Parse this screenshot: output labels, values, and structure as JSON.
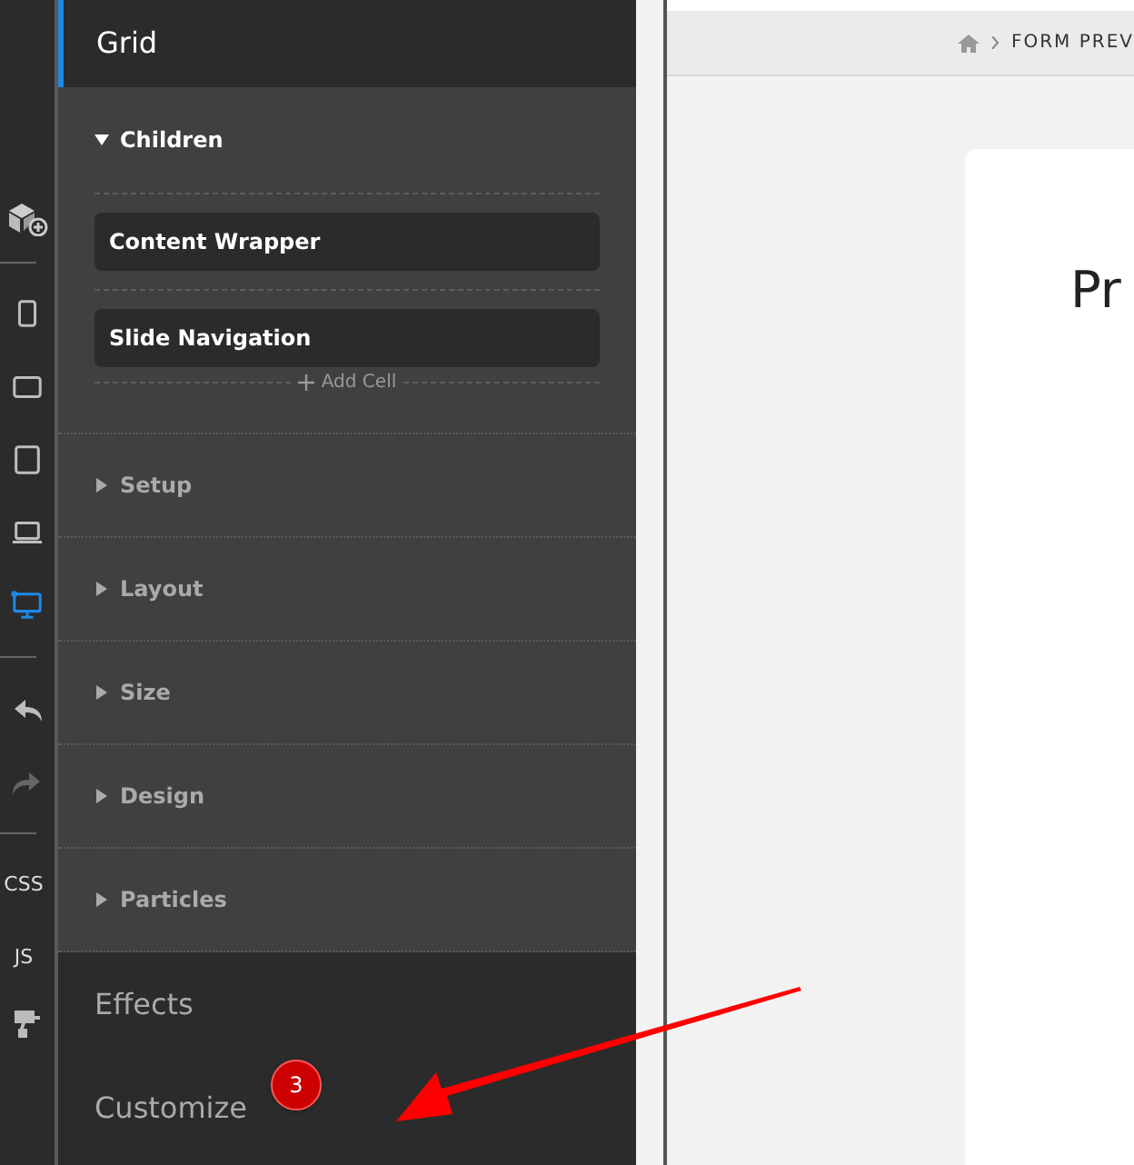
{
  "toolbar": {
    "devices": [
      {
        "kind": "phone",
        "selected": false
      },
      {
        "kind": "tablet-landscape",
        "selected": false
      },
      {
        "kind": "tablet",
        "selected": false
      },
      {
        "kind": "laptop",
        "selected": false
      },
      {
        "kind": "desktop",
        "selected": true
      }
    ],
    "history": [
      {
        "kind": "undo",
        "disabled": false
      },
      {
        "kind": "redo",
        "disabled": true
      }
    ],
    "code": [
      "CSS",
      "JS"
    ]
  },
  "panel": {
    "title": "Grid",
    "sections": [
      {
        "label": "Children",
        "expanded": true,
        "children": [
          "Content Wrapper",
          "Slide Navigation"
        ],
        "add_label": "Add Cell"
      },
      {
        "label": "Setup",
        "expanded": false
      },
      {
        "label": "Layout",
        "expanded": false
      },
      {
        "label": "Size",
        "expanded": false
      },
      {
        "label": "Design",
        "expanded": false
      },
      {
        "label": "Particles",
        "expanded": false
      }
    ],
    "tabs": [
      "Effects",
      "Customize"
    ]
  },
  "preview": {
    "breadcrumb": "FORM PREV",
    "heading": "Pr"
  },
  "annotation": {
    "badge": "3"
  }
}
